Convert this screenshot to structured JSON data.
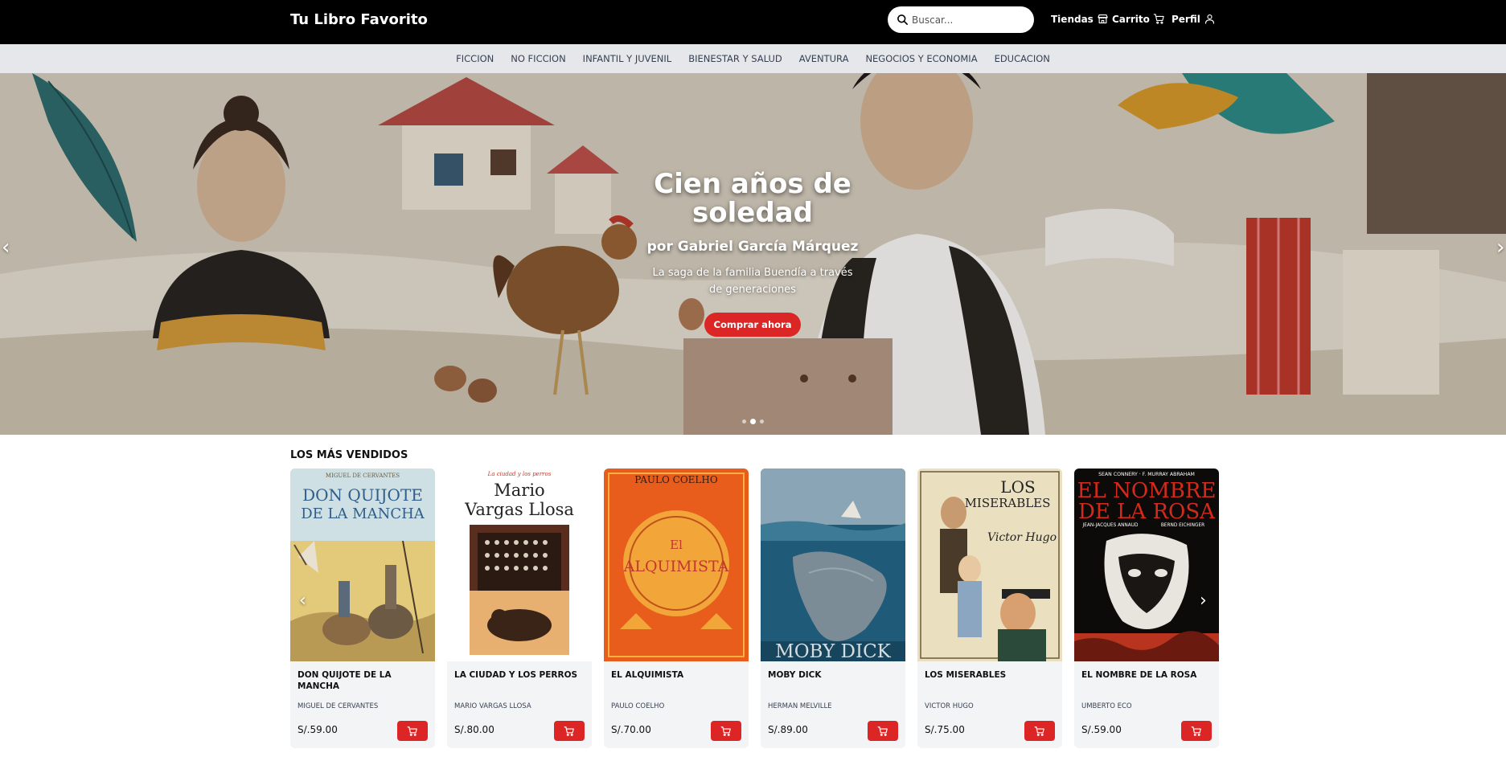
{
  "header": {
    "brand": "Tu Libro Favorito",
    "search_placeholder": "Buscar...",
    "stores_label": "Tiendas",
    "cart_label": "Carrito",
    "profile_label": "Perfil"
  },
  "categories": [
    "FICCION",
    "NO FICCION",
    "INFANTIL Y JUVENIL",
    "BIENESTAR Y SALUD",
    "AVENTURA",
    "NEGOCIOS Y ECONOMIA",
    "EDUCACION"
  ],
  "hero": {
    "title": "Cien años de soledad",
    "author": "por Gabriel García Márquez",
    "description": "La saga de la familia Buendía a través de generaciones",
    "button": "Comprar ahora",
    "slides": 3,
    "active_slide": 2
  },
  "bestsellers": {
    "title": "LOS MÁS VENDIDOS",
    "products": [
      {
        "title": "DON QUIJOTE DE LA MANCHA",
        "author": "MIGUEL DE CERVANTES",
        "price": "S/.59.00",
        "cover_text": [
          "MIGUEL DE CERVANTES",
          "DON QUIJOTE",
          "DE LA MANCHA"
        ]
      },
      {
        "title": "LA CIUDAD Y LOS PERROS",
        "author": "MARIO VARGAS LLOSA",
        "price": "S/.80.00",
        "cover_text": [
          "La ciudad y los perros",
          "Mario",
          "Vargas Llosa"
        ]
      },
      {
        "title": "EL ALQUIMISTA",
        "author": "PAULO COELHO",
        "price": "S/.70.00",
        "cover_text": [
          "PAULO COELHO",
          "El",
          "ALQUIMISTA"
        ]
      },
      {
        "title": "MOBY DICK",
        "author": "HERMAN MELVILLE",
        "price": "S/.89.00",
        "cover_text": [
          "MOBY DICK"
        ]
      },
      {
        "title": "LOS MISERABLES",
        "author": "VICTOR HUGO",
        "price": "S/.75.00",
        "cover_text": [
          "LOS",
          "MISERABLES",
          "Victor Hugo"
        ]
      },
      {
        "title": "EL NOMBRE DE LA ROSA",
        "author": "UMBERTO ECO",
        "price": "S/.59.00",
        "cover_text": [
          "SEAN CONNERY · F. MURRAY ABRAHAM",
          "EL NOMBRE",
          "DE LA ROSA",
          "JEAN-JACQUES ANNAUD",
          "BERND EICHINGER"
        ]
      }
    ]
  },
  "colors": {
    "topbar": "#000000",
    "category_bar": "#e5e7eb",
    "accent": "#dc2626",
    "card_bg": "#f3f4f6"
  }
}
